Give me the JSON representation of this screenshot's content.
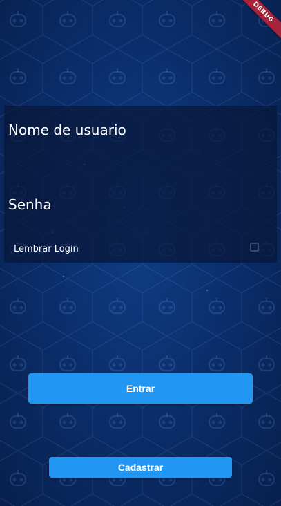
{
  "debug_banner": {
    "label": "DEBUG"
  },
  "form": {
    "username_label": "Nome de usuario",
    "password_label": "Senha",
    "remember_label": "Lembrar Login",
    "remember_checked": false
  },
  "buttons": {
    "login_label": "Entrar",
    "register_label": "Cadastrar"
  },
  "colors": {
    "primary_button": "#2196f3",
    "background": "#0b2f6c",
    "debug_ribbon": "#a6233a"
  }
}
